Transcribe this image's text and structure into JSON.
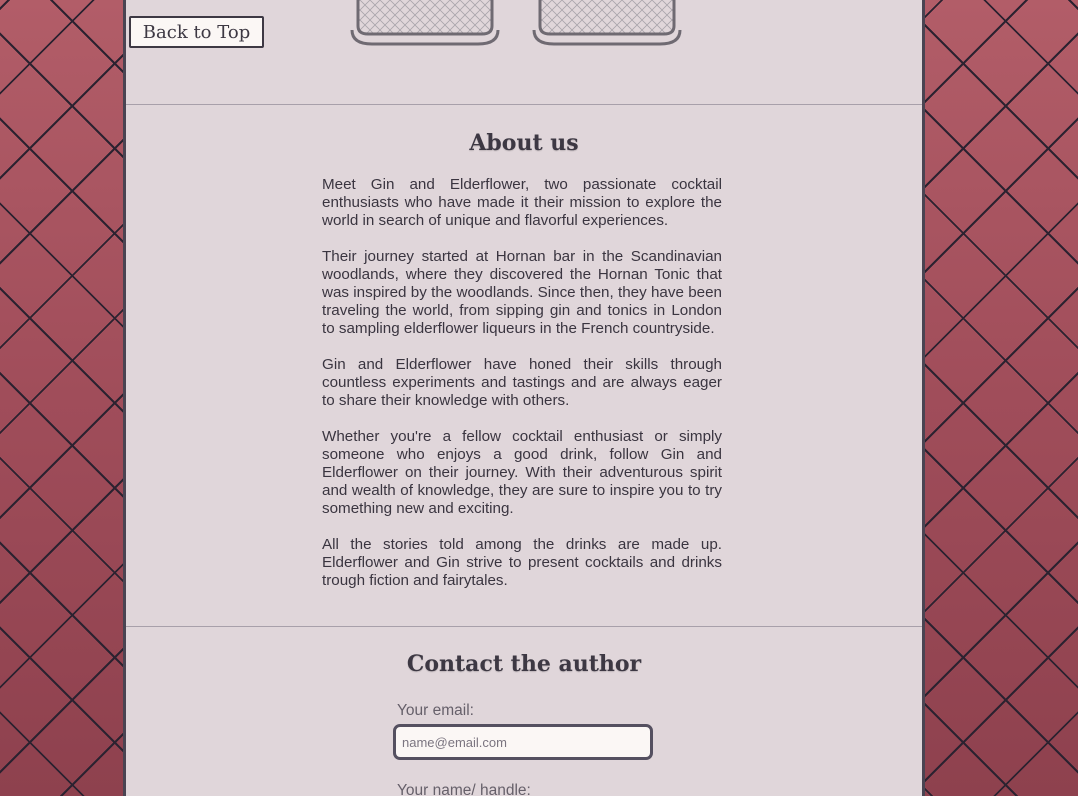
{
  "nav": {
    "back_to_top": "Back to Top"
  },
  "about": {
    "title": "About us",
    "paragraphs": [
      "Meet Gin and Elderflower, two passionate cocktail enthusiasts who have made it their mission to explore the world in search of unique and flavorful experiences.",
      "Their journey started at Hornan bar in the Scandinavian woodlands, where they discovered the Hornan Tonic that was inspired by the woodlands. Since then, they have been traveling the world, from sipping gin and tonics in London to sampling elderflower liqueurs in the French countryside.",
      "Gin and Elderflower have honed their skills through countless experiments and tastings and are always eager to share their knowledge with others.",
      "Whether you're a fellow cocktail enthusiast or simply someone who enjoys a good drink, follow Gin and Elderflower on their journey. With their adventurous spirit and wealth of knowledge, they are sure to inspire you to try something new and exciting.",
      "All the stories told among the drinks are made up. Elderflower and Gin strive to present cocktails and drinks trough fiction and fairytales."
    ]
  },
  "contact": {
    "title": "Contact the author",
    "email_label": "Your email:",
    "email_placeholder": "name@email.com",
    "email_value": "",
    "name_label": "Your name/ handle:"
  },
  "colors": {
    "background": "#a04d5a",
    "pattern_lines": "#2c2230",
    "panel": "#e0d6da",
    "text": "#3a3540",
    "border": "#4a4452"
  },
  "icons": {
    "glass_left": "cocktail-glass-icon",
    "glass_right": "cocktail-glass-icon"
  }
}
